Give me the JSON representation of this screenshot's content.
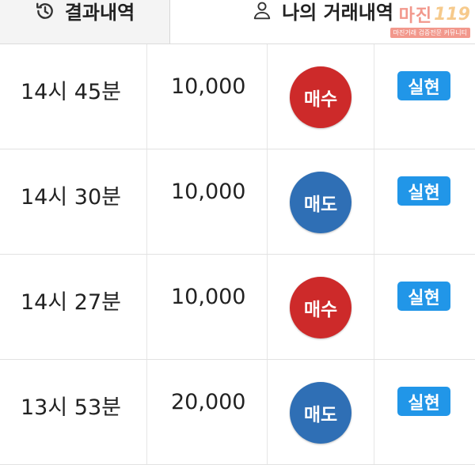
{
  "tabs": {
    "results_label": "결과내역",
    "mine_label": "나의 거래내역"
  },
  "watermark": {
    "logo": "마진",
    "num": "119",
    "sub": "마진거래 검증전문 커뮤니티"
  },
  "colors": {
    "buy": "#cd2a2a",
    "sell": "#2f6fb5",
    "status": "#2196e8"
  },
  "rows": [
    {
      "time": "14시 45분",
      "amount": "10,000",
      "type": "매수",
      "type_kind": "buy",
      "status": "실현"
    },
    {
      "time": "14시 30분",
      "amount": "10,000",
      "type": "매도",
      "type_kind": "sell",
      "status": "실현"
    },
    {
      "time": "14시 27분",
      "amount": "10,000",
      "type": "매수",
      "type_kind": "buy",
      "status": "실현"
    },
    {
      "time": "13시 53분",
      "amount": "20,000",
      "type": "매도",
      "type_kind": "sell",
      "status": "실현"
    }
  ]
}
